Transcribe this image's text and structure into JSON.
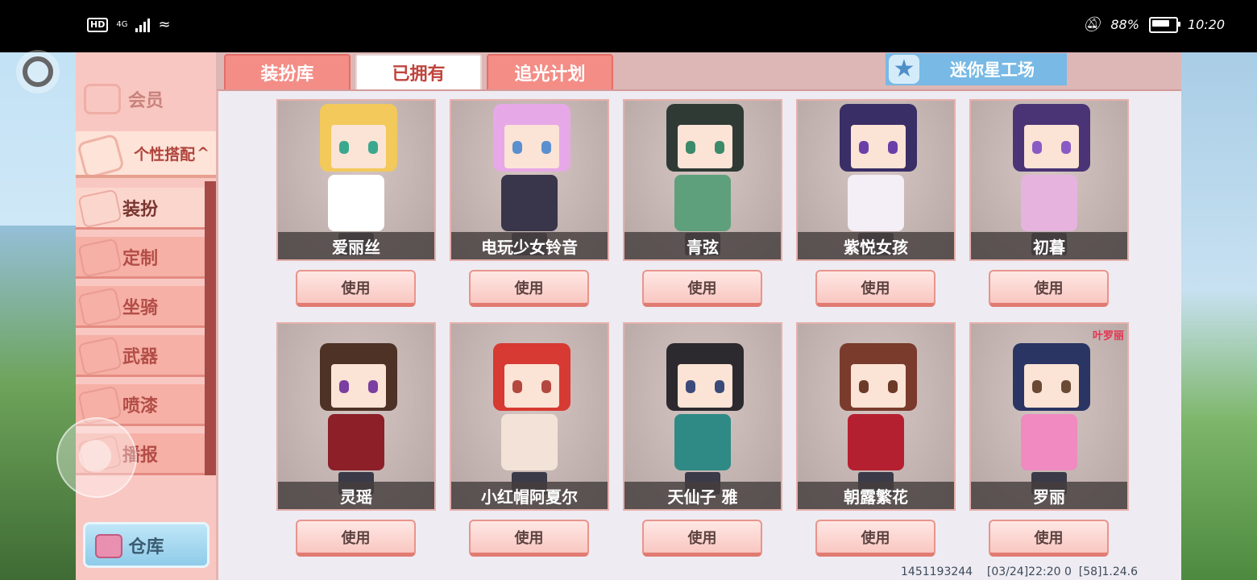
{
  "status_bar": {
    "hd": "HD",
    "network": "4G",
    "battery": "88%",
    "battery_level": 0.88,
    "time": "10:20"
  },
  "sidebar": {
    "vip": "会员",
    "group": "个性搭配",
    "group_arrow": "^",
    "items": [
      {
        "label": "装扮",
        "icon": "shirt-icon",
        "active": true
      },
      {
        "label": "定制",
        "icon": "pencil-icon",
        "active": false
      },
      {
        "label": "坐骑",
        "icon": "mount-icon",
        "active": false
      },
      {
        "label": "武器",
        "icon": "gun-icon",
        "active": false
      },
      {
        "label": "喷漆",
        "icon": "spray-can-icon",
        "active": false
      },
      {
        "label": "播报",
        "icon": "broadcast-icon",
        "active": false
      }
    ],
    "warehouse": "仓库"
  },
  "tabs": [
    {
      "label": "装扮库",
      "active": false
    },
    {
      "label": "已拥有",
      "active": true
    },
    {
      "label": "追光计划",
      "active": false
    }
  ],
  "workshop": {
    "label": "迷你星工场",
    "icon": "star-icon"
  },
  "skins": [
    {
      "name": "爱丽丝",
      "button": "使用",
      "hair": "#f2c95a",
      "outfit": "#ffffff",
      "eye": "#3aa88f"
    },
    {
      "name": "电玩少女铃音",
      "button": "使用",
      "hair": "#e7a8e8",
      "outfit": "#39354a",
      "eye": "#5a8fd0"
    },
    {
      "name": "青弦",
      "button": "使用",
      "hair": "#2f3a35",
      "outfit": "#5fa07c",
      "eye": "#3b8a6a"
    },
    {
      "name": "紫悦女孩",
      "button": "使用",
      "hair": "#3a2e66",
      "outfit": "#f4eef6",
      "eye": "#6a3fa8"
    },
    {
      "name": "初暮",
      "button": "使用",
      "hair": "#4a3475",
      "outfit": "#e6b3df",
      "eye": "#8a5ac4"
    },
    {
      "name": "灵瑶",
      "button": "使用",
      "hair": "#4d3225",
      "outfit": "#8c1f28",
      "eye": "#7a3fa0"
    },
    {
      "name": "小红帽阿夏尔",
      "button": "使用",
      "hair": "#d63a32",
      "outfit": "#f2e2d8",
      "eye": "#b3483f"
    },
    {
      "name": "天仙子 雅",
      "button": "使用",
      "hair": "#2c2a2e",
      "outfit": "#2f8a86",
      "eye": "#3b4a7a"
    },
    {
      "name": "朝露繁花",
      "button": "使用",
      "hair": "#7a3b2c",
      "outfit": "#b52030",
      "eye": "#6b3a28"
    },
    {
      "name": "罗丽",
      "button": "使用",
      "hair": "#2a3563",
      "outfit": "#f08ac0",
      "eye": "#6b4a35",
      "badge": "叶罗丽"
    }
  ],
  "footer": {
    "uid": "1451193244",
    "info": "[03/24]22:20 0  [58]1.24.6"
  }
}
